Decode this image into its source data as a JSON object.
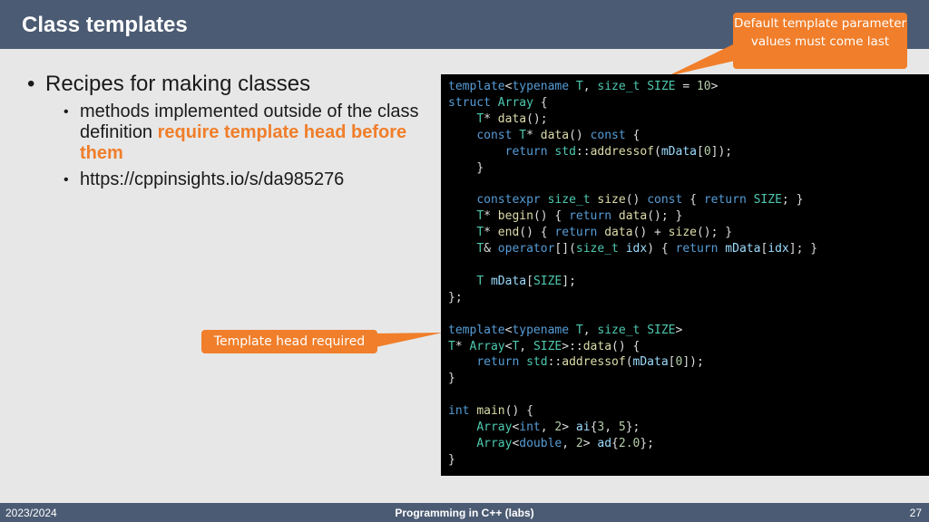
{
  "header": {
    "title": "Class templates"
  },
  "bullets": {
    "main": "Recipes for making classes",
    "sub1_text": "methods implemented outside of the class definition ",
    "sub1_highlight": "require template head before them",
    "sub2": "https://cppinsights.io/s/da985276"
  },
  "callouts": {
    "top": "Default template parameter values must come last",
    "middle": "Template head required"
  },
  "code": {
    "language": "C++",
    "lines": [
      "template<typename T, size_t SIZE = 10>",
      "struct Array {",
      "    T* data();",
      "    const T* data() const {",
      "        return std::addressof(mData[0]);",
      "    }",
      "",
      "    constexpr size_t size() const { return SIZE; }",
      "    T* begin() { return data(); }",
      "    T* end() { return data() + size(); }",
      "    T& operator[](size_t idx) { return mData[idx]; }",
      "",
      "    T mData[SIZE];",
      "};",
      "",
      "template<typename T, size_t SIZE>",
      "T* Array<T, SIZE>::data() {",
      "    return std::addressof(mData[0]);",
      "}",
      "",
      "int main() {",
      "    Array<int, 2> ai{3, 5};",
      "    Array<double, 2> ad{2.0};",
      "}"
    ]
  },
  "footer": {
    "left": "2023/2024",
    "center": "Programming in C++ (labs)",
    "right": "27"
  },
  "colors": {
    "header_bg": "#4b5b73",
    "accent": "#f07e2a",
    "slide_bg": "#e7e7e7",
    "code_bg": "#000000"
  }
}
